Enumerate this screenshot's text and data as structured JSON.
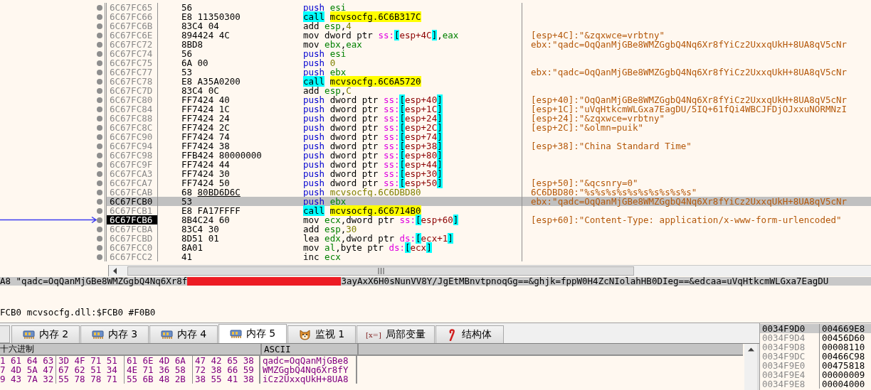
{
  "disassembly": {
    "rows": [
      {
        "address": "6C67FC65",
        "bytes": "56",
        "instruction": [
          {
            "text": "push ",
            "kind": "push"
          },
          {
            "text": "esi",
            "kind": "reg"
          }
        ],
        "selected": false,
        "current": false
      },
      {
        "address": "6C67FC66",
        "bytes": "E8 11350300",
        "instruction": [
          {
            "text": "call",
            "kind": "call"
          },
          {
            "text": "mcvsocfg.6C6B317C",
            "kind": "sym"
          }
        ],
        "selected": false,
        "current": false
      },
      {
        "address": "6C67FC6B",
        "bytes": "83C4 04",
        "instruction": [
          {
            "text": "add ",
            "kind": "op"
          },
          {
            "text": "esp",
            "kind": "reg"
          },
          {
            "text": ",",
            "kind": "plain"
          },
          {
            "text": "4",
            "kind": "num"
          }
        ],
        "selected": false,
        "current": false
      },
      {
        "address": "6C67FC6E",
        "bytes": "894424 4C",
        "instruction": [
          {
            "text": "mov ",
            "kind": "op"
          },
          {
            "text": "dword ptr ",
            "kind": "plain"
          },
          {
            "text": "ss:",
            "kind": "seg"
          },
          {
            "text": "[",
            "kind": "bracket"
          },
          {
            "text": "esp+4C",
            "kind": "mem"
          },
          {
            "text": "]",
            "kind": "bracket"
          },
          {
            "text": ",",
            "kind": "plain"
          },
          {
            "text": "eax",
            "kind": "reg"
          }
        ],
        "comment": "[esp+4C]:\"&zqxwce=vrbtny\"",
        "selected": false,
        "current": false
      },
      {
        "address": "6C67FC72",
        "bytes": "8BD8",
        "instruction": [
          {
            "text": "mov ",
            "kind": "op"
          },
          {
            "text": "ebx",
            "kind": "reg"
          },
          {
            "text": ",",
            "kind": "plain"
          },
          {
            "text": "eax",
            "kind": "reg"
          }
        ],
        "comment": "ebx:\"qadc=OqQanMjGBe8WMZGgbQ4Nq6Xr8fYiCz2UxxqUkH+8UA8qV5cNr",
        "selected": false,
        "current": false
      },
      {
        "address": "6C67FC74",
        "bytes": "56",
        "instruction": [
          {
            "text": "push ",
            "kind": "push"
          },
          {
            "text": "esi",
            "kind": "reg"
          }
        ],
        "selected": false,
        "current": false
      },
      {
        "address": "6C67FC75",
        "bytes": "6A 00",
        "instruction": [
          {
            "text": "push ",
            "kind": "push"
          },
          {
            "text": "0",
            "kind": "num"
          }
        ],
        "selected": false,
        "current": false
      },
      {
        "address": "6C67FC77",
        "bytes": "53",
        "instruction": [
          {
            "text": "push ",
            "kind": "push"
          },
          {
            "text": "ebx",
            "kind": "reg"
          }
        ],
        "comment": "ebx:\"qadc=OqQanMjGBe8WMZGgbQ4Nq6Xr8fYiCz2UxxqUkH+8UA8qV5cNr",
        "selected": false,
        "current": false
      },
      {
        "address": "6C67FC78",
        "bytes": "E8 A35A0200",
        "instruction": [
          {
            "text": "call",
            "kind": "call"
          },
          {
            "text": "mcvsocfg.6C6A5720",
            "kind": "sym"
          }
        ],
        "selected": false,
        "current": false
      },
      {
        "address": "6C67FC7D",
        "bytes": "83C4 0C",
        "instruction": [
          {
            "text": "add ",
            "kind": "op"
          },
          {
            "text": "esp",
            "kind": "reg"
          },
          {
            "text": ",",
            "kind": "plain"
          },
          {
            "text": "C",
            "kind": "num"
          }
        ],
        "selected": false,
        "current": false
      },
      {
        "address": "6C67FC80",
        "bytes": "FF7424 40",
        "instruction": [
          {
            "text": "push ",
            "kind": "push"
          },
          {
            "text": "dword ptr ",
            "kind": "plain"
          },
          {
            "text": "ss:",
            "kind": "seg"
          },
          {
            "text": "[",
            "kind": "bracket"
          },
          {
            "text": "esp+40",
            "kind": "mem"
          },
          {
            "text": "]",
            "kind": "bracket"
          }
        ],
        "comment": "[esp+40]:\"OqQanMjGBe8WMZGgbQ4Nq6Xr8fYiCz2UxxqUkH+8UA8qV5cNr",
        "selected": false,
        "current": false
      },
      {
        "address": "6C67FC84",
        "bytes": "FF7424 1C",
        "instruction": [
          {
            "text": "push ",
            "kind": "push"
          },
          {
            "text": "dword ptr ",
            "kind": "plain"
          },
          {
            "text": "ss:",
            "kind": "seg"
          },
          {
            "text": "[",
            "kind": "bracket"
          },
          {
            "text": "esp+1C",
            "kind": "mem"
          },
          {
            "text": "]",
            "kind": "bracket"
          }
        ],
        "comment": "[esp+1C]:\"uVqHtkcmWLGxa7EagDU/5IQ+61fQi4WBCJFDjOJxxuNORMNzI",
        "selected": false,
        "current": false
      },
      {
        "address": "6C67FC88",
        "bytes": "FF7424 24",
        "instruction": [
          {
            "text": "push ",
            "kind": "push"
          },
          {
            "text": "dword ptr ",
            "kind": "plain"
          },
          {
            "text": "ss:",
            "kind": "seg"
          },
          {
            "text": "[",
            "kind": "bracket"
          },
          {
            "text": "esp+24",
            "kind": "mem"
          },
          {
            "text": "]",
            "kind": "bracket"
          }
        ],
        "comment": "[esp+24]:\"&zqxwce=vrbtny\"",
        "selected": false,
        "current": false
      },
      {
        "address": "6C67FC8C",
        "bytes": "FF7424 2C",
        "instruction": [
          {
            "text": "push ",
            "kind": "push"
          },
          {
            "text": "dword ptr ",
            "kind": "plain"
          },
          {
            "text": "ss:",
            "kind": "seg"
          },
          {
            "text": "[",
            "kind": "bracket"
          },
          {
            "text": "esp+2C",
            "kind": "mem"
          },
          {
            "text": "]",
            "kind": "bracket"
          }
        ],
        "comment": "[esp+2C]:\"&olmn=puik\"",
        "selected": false,
        "current": false
      },
      {
        "address": "6C67FC90",
        "bytes": "FF7424 74",
        "instruction": [
          {
            "text": "push ",
            "kind": "push"
          },
          {
            "text": "dword ptr ",
            "kind": "plain"
          },
          {
            "text": "ss:",
            "kind": "seg"
          },
          {
            "text": "[",
            "kind": "bracket"
          },
          {
            "text": "esp+74",
            "kind": "mem"
          },
          {
            "text": "]",
            "kind": "bracket"
          }
        ],
        "selected": false,
        "current": false
      },
      {
        "address": "6C67FC94",
        "bytes": "FF7424 38",
        "instruction": [
          {
            "text": "push ",
            "kind": "push"
          },
          {
            "text": "dword ptr ",
            "kind": "plain"
          },
          {
            "text": "ss:",
            "kind": "seg"
          },
          {
            "text": "[",
            "kind": "bracket"
          },
          {
            "text": "esp+38",
            "kind": "mem"
          },
          {
            "text": "]",
            "kind": "bracket"
          }
        ],
        "comment": "[esp+38]:\"China Standard Time\"",
        "selected": false,
        "current": false
      },
      {
        "address": "6C67FC98",
        "bytes": "FFB424 80000000",
        "instruction": [
          {
            "text": "push ",
            "kind": "push"
          },
          {
            "text": "dword ptr ",
            "kind": "plain"
          },
          {
            "text": "ss:",
            "kind": "seg"
          },
          {
            "text": "[",
            "kind": "bracket"
          },
          {
            "text": "esp+80",
            "kind": "mem"
          },
          {
            "text": "]",
            "kind": "bracket"
          }
        ],
        "selected": false,
        "current": false
      },
      {
        "address": "6C67FC9F",
        "bytes": "FF7424 44",
        "instruction": [
          {
            "text": "push ",
            "kind": "push"
          },
          {
            "text": "dword ptr ",
            "kind": "plain"
          },
          {
            "text": "ss:",
            "kind": "seg"
          },
          {
            "text": "[",
            "kind": "bracket"
          },
          {
            "text": "esp+44",
            "kind": "mem"
          },
          {
            "text": "]",
            "kind": "bracket"
          }
        ],
        "selected": false,
        "current": false
      },
      {
        "address": "6C67FCA3",
        "bytes": "FF7424 30",
        "instruction": [
          {
            "text": "push ",
            "kind": "push"
          },
          {
            "text": "dword ptr ",
            "kind": "plain"
          },
          {
            "text": "ss:",
            "kind": "seg"
          },
          {
            "text": "[",
            "kind": "bracket"
          },
          {
            "text": "esp+30",
            "kind": "mem"
          },
          {
            "text": "]",
            "kind": "bracket"
          }
        ],
        "selected": false,
        "current": false
      },
      {
        "address": "6C67FCA7",
        "bytes": "FF7424 50",
        "instruction": [
          {
            "text": "push ",
            "kind": "push"
          },
          {
            "text": "dword ptr ",
            "kind": "plain"
          },
          {
            "text": "ss:",
            "kind": "seg"
          },
          {
            "text": "[",
            "kind": "bracket"
          },
          {
            "text": "esp+50",
            "kind": "mem"
          },
          {
            "text": "]",
            "kind": "bracket"
          }
        ],
        "comment": "[esp+50]:\"&qcsnry=0\"",
        "selected": false,
        "current": false
      },
      {
        "address": "6C67FCAB",
        "bytes": "68 ",
        "bytes_ref": "80BD6D6C",
        "instruction": [
          {
            "text": "push ",
            "kind": "push"
          },
          {
            "text": "mcvsocfg.6C6DBD80",
            "kind": "addr"
          }
        ],
        "comment": "6C6DBD80:\"%s%s%s%s%s%s%s%s%s%s\"",
        "selected": false,
        "current": false
      },
      {
        "address": "6C67FCB0",
        "bytes": "53",
        "instruction": [
          {
            "text": "push ",
            "kind": "push"
          },
          {
            "text": "ebx",
            "kind": "reg"
          }
        ],
        "comment": "ebx:\"qadc=OqQanMjGBe8WMZGgbQ4Nq6Xr8fYiCz2UxxqUkH+8UA8qV5cNr",
        "selected": true,
        "current": false
      },
      {
        "address": "6C67FCB1",
        "bytes": "E8 FA17FFFF",
        "instruction": [
          {
            "text": "call",
            "kind": "call"
          },
          {
            "text": "mcvsocfg.6C6714B0",
            "kind": "sym"
          }
        ],
        "selected": false,
        "current": false
      },
      {
        "address": "6C67FCB6",
        "bytes": "8B4C24 60",
        "instruction": [
          {
            "text": "mov ",
            "kind": "op"
          },
          {
            "text": "ecx",
            "kind": "reg"
          },
          {
            "text": ",",
            "kind": "plain"
          },
          {
            "text": "dword ptr ",
            "kind": "plain"
          },
          {
            "text": "ss:",
            "kind": "seg"
          },
          {
            "text": "[",
            "kind": "bracket"
          },
          {
            "text": "esp+60",
            "kind": "mem"
          },
          {
            "text": "]",
            "kind": "bracket"
          }
        ],
        "comment": "[esp+60]:\"Content-Type: application/x-www-form-urlencoded\"",
        "selected": false,
        "current": true
      },
      {
        "address": "6C67FCBA",
        "bytes": "83C4 30",
        "instruction": [
          {
            "text": "add ",
            "kind": "op"
          },
          {
            "text": "esp",
            "kind": "reg"
          },
          {
            "text": ",",
            "kind": "plain"
          },
          {
            "text": "30",
            "kind": "num"
          }
        ],
        "selected": false,
        "current": false
      },
      {
        "address": "6C67FCBD",
        "bytes": "8D51 01",
        "instruction": [
          {
            "text": "lea ",
            "kind": "op"
          },
          {
            "text": "edx",
            "kind": "reg"
          },
          {
            "text": ",",
            "kind": "plain"
          },
          {
            "text": "dword ptr ",
            "kind": "plain"
          },
          {
            "text": "ds:",
            "kind": "seg"
          },
          {
            "text": "[",
            "kind": "bracket"
          },
          {
            "text": "ecx+1",
            "kind": "mem"
          },
          {
            "text": "]",
            "kind": "bracket"
          }
        ],
        "selected": false,
        "current": false
      },
      {
        "address": "6C67FCC0",
        "bytes": "8A01",
        "instruction": [
          {
            "text": "mov ",
            "kind": "op"
          },
          {
            "text": "al",
            "kind": "reg"
          },
          {
            "text": ",",
            "kind": "plain"
          },
          {
            "text": "byte ptr ",
            "kind": "plain"
          },
          {
            "text": "ds:",
            "kind": "seg"
          },
          {
            "text": "[",
            "kind": "bracket"
          },
          {
            "text": "ecx",
            "kind": "mem"
          },
          {
            "text": "]",
            "kind": "bracket"
          }
        ],
        "selected": false,
        "current": false
      },
      {
        "address": "6C67FCC2",
        "bytes": "41",
        "instruction": [
          {
            "text": "inc ",
            "kind": "op"
          },
          {
            "text": "ecx",
            "kind": "reg"
          }
        ],
        "selected": false,
        "current": false
      }
    ]
  },
  "info": {
    "value_prefix": "A8 \"qadc=OqQanMjGBe8WMZGgbQ4Nq6Xr8f",
    "value_suffix": "3ayAxX6H0sNunVV8Y/JgEtMBnvtpnoqGg==&ghjk=fppW0H4ZcNIolahHB0DIeg==&edcaa=uVqHtkcmWLGxa7EagDU",
    "location": "FCB0 mcvsocfg.dll:$FCB0 #F0B0"
  },
  "tabs": [
    {
      "label": "内存 2",
      "kind": "memory",
      "selected": false
    },
    {
      "label": "内存 3",
      "kind": "memory",
      "selected": false
    },
    {
      "label": "内存 4",
      "kind": "memory",
      "selected": false
    },
    {
      "label": "内存 5",
      "kind": "memory",
      "selected": true
    },
    {
      "label": "监视 1",
      "kind": "watch",
      "selected": false
    },
    {
      "label": "局部变量",
      "kind": "variables",
      "icon_text": "[x=]",
      "selected": false
    },
    {
      "label": "结构体",
      "kind": "struct",
      "selected": false
    }
  ],
  "hex_dump": {
    "columns": [
      "十六进制",
      "ASCII"
    ],
    "rows": [
      {
        "groups": [
          "1 61 64 63",
          "3D 4F 71 51",
          "61 6E 4D 6A",
          "47 42 65 38"
        ],
        "ascii": "qadc=OqQanMjGBe8"
      },
      {
        "groups": [
          "7 4D 5A 47",
          "67 62 51 34",
          "4E 71 36 58",
          "72 38 66 59"
        ],
        "ascii": "WMZGgbQ4Nq6Xr8fY"
      },
      {
        "groups": [
          "9 43 7A 32",
          "55 78 78 71",
          "55 6B 48 2B",
          "38 55 41 38"
        ],
        "ascii": "iCz2UxxqUkH+8UA8"
      }
    ]
  },
  "stack": {
    "rows": [
      {
        "address": "0034F9D0",
        "value": "004669E8",
        "selected": true
      },
      {
        "address": "0034F9D4",
        "value": "00456D60",
        "selected": false
      },
      {
        "address": "0034F9D8",
        "value": "00008110",
        "selected": false
      },
      {
        "address": "0034F9DC",
        "value": "00466C98",
        "selected": false
      },
      {
        "address": "0034F9E0",
        "value": "00475818",
        "selected": false
      },
      {
        "address": "0034F9E4",
        "value": "00000009",
        "selected": false
      },
      {
        "address": "0034F9E8",
        "value": "00004000",
        "selected": false
      }
    ]
  }
}
